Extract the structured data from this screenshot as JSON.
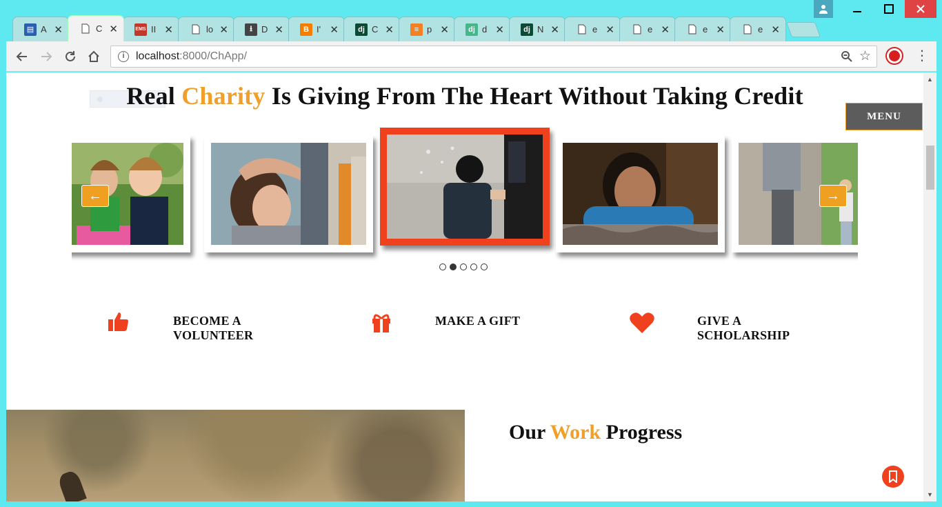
{
  "browser": {
    "tabs": [
      {
        "title": "A",
        "favicon": "document-chart-icon",
        "fav_color": "#2b5fae",
        "active": false
      },
      {
        "title": "C",
        "favicon": "page-icon",
        "fav_color": "#666666",
        "active": true
      },
      {
        "title": "II",
        "favicon": "ems-icon",
        "fav_color": "#c0392b",
        "active": false
      },
      {
        "title": "lo",
        "favicon": "page-icon",
        "fav_color": "#666666",
        "active": false
      },
      {
        "title": "D",
        "favicon": "download-icon",
        "fav_color": "#444444",
        "active": false
      },
      {
        "title": "I'",
        "favicon": "blogger-icon",
        "fav_color": "#f57d00",
        "active": false
      },
      {
        "title": "C",
        "favicon": "django-icon",
        "fav_color": "#0c4b33",
        "active": false
      },
      {
        "title": "p",
        "favicon": "stackoverflow-icon",
        "fav_color": "#f48024",
        "active": false
      },
      {
        "title": "d",
        "favicon": "django-icon",
        "fav_color": "#44b78b",
        "active": false
      },
      {
        "title": "N",
        "favicon": "django-icon",
        "fav_color": "#0c4b33",
        "active": false
      },
      {
        "title": "e",
        "favicon": "page-icon",
        "fav_color": "#666666",
        "active": false
      },
      {
        "title": "e",
        "favicon": "page-icon",
        "fav_color": "#666666",
        "active": false
      },
      {
        "title": "e",
        "favicon": "page-icon",
        "fav_color": "#666666",
        "active": false
      },
      {
        "title": "e",
        "favicon": "page-icon",
        "fav_color": "#666666",
        "active": false
      }
    ],
    "url_host": "localhost",
    "url_rest": ":8000/ChApp/"
  },
  "page": {
    "headline_before": "Real ",
    "headline_accent": "Charity",
    "headline_after": " Is Giving From The Heart Without Taking Credit",
    "menu_label": "MENU",
    "accent_color": "#f0a02a",
    "highlight_color": "#f0411f",
    "carousel": {
      "prev_label": "←",
      "next_label": "→",
      "slides": [
        {
          "scene": "two-boys-playing"
        },
        {
          "scene": "child-hand-on-head"
        },
        {
          "scene": "boy-walking-with-parent"
        },
        {
          "scene": "smiling-girl"
        },
        {
          "scene": "man-walking-with-child"
        }
      ],
      "dot_count": 5,
      "active_dot": 1
    },
    "features": [
      {
        "label_line1": "BECOME A",
        "label_line2": "VOLUNTEER",
        "icon": "thumbs-up-icon"
      },
      {
        "label_line1": "MAKE A GIFT",
        "label_line2": "",
        "icon": "gift-icon"
      },
      {
        "label_line1": "GIVE A",
        "label_line2": "SCHOLARSHIP",
        "icon": "heart-icon"
      }
    ],
    "work_before": "Our ",
    "work_accent": "Work",
    "work_after": " Progress"
  }
}
